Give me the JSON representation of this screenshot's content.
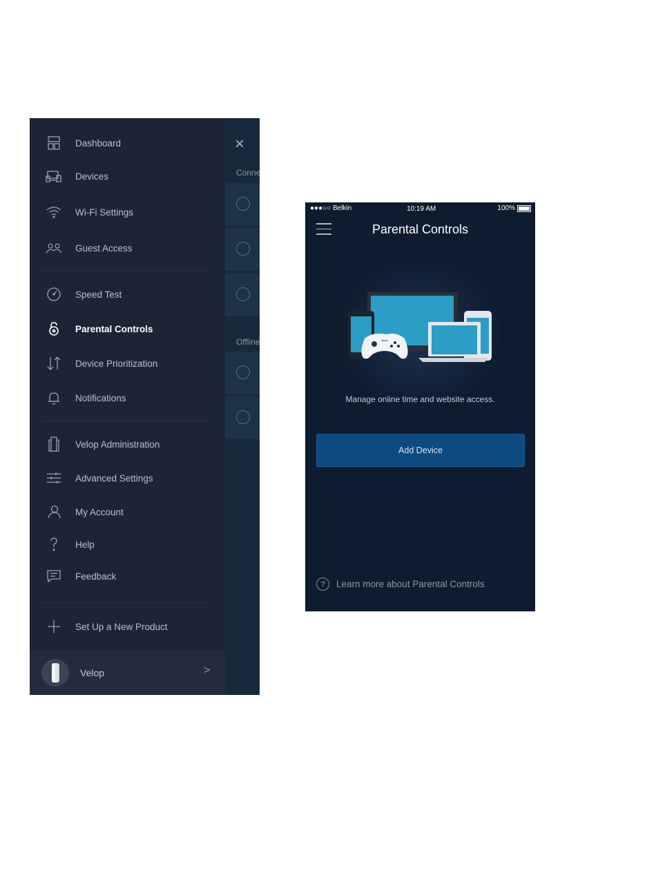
{
  "drawer": {
    "items": [
      {
        "label": "Dashboard",
        "icon": "dashboard-icon"
      },
      {
        "label": "Devices",
        "icon": "devices-icon"
      },
      {
        "label": "Wi-Fi Settings",
        "icon": "wifi-icon"
      },
      {
        "label": "Guest Access",
        "icon": "guest-access-icon"
      },
      {
        "label": "Speed Test",
        "icon": "speedometer-icon"
      },
      {
        "label": "Parental Controls",
        "icon": "lock-icon",
        "active": true
      },
      {
        "label": "Device Prioritization",
        "icon": "prioritization-arrows-icon"
      },
      {
        "label": "Notifications",
        "icon": "bell-icon"
      },
      {
        "label": "Velop Administration",
        "icon": "velop-admin-icon"
      },
      {
        "label": "Advanced Settings",
        "icon": "sliders-icon"
      },
      {
        "label": "My Account",
        "icon": "user-icon"
      },
      {
        "label": "Help",
        "icon": "help-icon"
      },
      {
        "label": "Feedback",
        "icon": "feedback-icon"
      },
      {
        "label": "Set Up a New Product",
        "icon": "plus-icon"
      }
    ],
    "footer": {
      "label": "Velop",
      "chevron": ">"
    }
  },
  "behind_panel": {
    "close": "×",
    "section_connected": "Conne",
    "section_offline": "Offline"
  },
  "phone": {
    "status": {
      "carrier": "●●●○○ Belkin",
      "time": "10:19 AM",
      "battery": "100%"
    },
    "title": "Parental Controls",
    "description": "Manage online time and website access.",
    "add_button": "Add Device",
    "learn_more": "Learn more about Parental Controls",
    "learn_icon": "?"
  },
  "colors": {
    "drawer_bg": "#1c2535",
    "phone_bg": "#13223a",
    "button_bg": "#0d4a82"
  }
}
